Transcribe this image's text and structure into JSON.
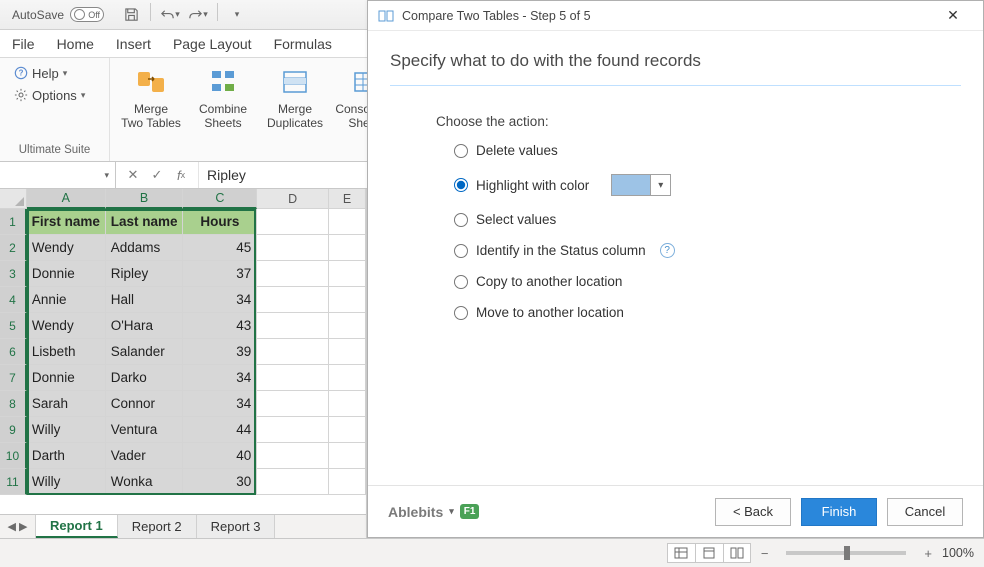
{
  "titlebar": {
    "autosave_label": "AutoSave",
    "autosave_state": "Off"
  },
  "ribbon": {
    "tabs": [
      "File",
      "Home",
      "Insert",
      "Page Layout",
      "Formulas"
    ],
    "help_label": "Help",
    "options_label": "Options",
    "group1_label": "Ultimate Suite",
    "big_buttons": {
      "merge_tables": "Merge\nTwo Tables",
      "combine_sheets": "Combine\nSheets",
      "merge_duplicates": "Merge\nDuplicates",
      "consolidate_sheets": "Consolidate\nSheets"
    }
  },
  "formula": {
    "namebox": "",
    "value": "Ripley"
  },
  "columns": [
    "A",
    "B",
    "C",
    "D",
    "E"
  ],
  "headers": {
    "A": "First name",
    "B": "Last name",
    "C": "Hours"
  },
  "rows": [
    {
      "n": 1
    },
    {
      "n": 2,
      "a": "Wendy",
      "b": "Addams",
      "c": 45
    },
    {
      "n": 3,
      "a": "Donnie",
      "b": "Ripley",
      "c": 37
    },
    {
      "n": 4,
      "a": "Annie",
      "b": "Hall",
      "c": 34
    },
    {
      "n": 5,
      "a": "Wendy",
      "b": "O'Hara",
      "c": 43
    },
    {
      "n": 6,
      "a": "Lisbeth",
      "b": "Salander",
      "c": 39
    },
    {
      "n": 7,
      "a": "Donnie",
      "b": "Darko",
      "c": 34
    },
    {
      "n": 8,
      "a": "Sarah",
      "b": "Connor",
      "c": 34
    },
    {
      "n": 9,
      "a": "Willy",
      "b": "Ventura",
      "c": 44
    },
    {
      "n": 10,
      "a": "Darth",
      "b": "Vader",
      "c": 40
    },
    {
      "n": 11,
      "a": "Willy",
      "b": "Wonka",
      "c": 30
    }
  ],
  "sheets": {
    "tabs": [
      "Report 1",
      "Report 2",
      "Report 3"
    ],
    "active": 0
  },
  "status": {
    "zoom_pct": "100%"
  },
  "dialog": {
    "title": "Compare Two Tables - Step 5 of 5",
    "heading": "Specify what to do with the found records",
    "choose_label": "Choose the action:",
    "actions": {
      "delete": "Delete values",
      "highlight": "Highlight with color",
      "select": "Select values",
      "status": "Identify in the Status column",
      "copy": "Copy to another location",
      "move": "Move to another location"
    },
    "highlight_color": "#9dc3e6",
    "brand": "Ablebits",
    "back": "< Back",
    "finish": "Finish",
    "cancel": "Cancel"
  }
}
